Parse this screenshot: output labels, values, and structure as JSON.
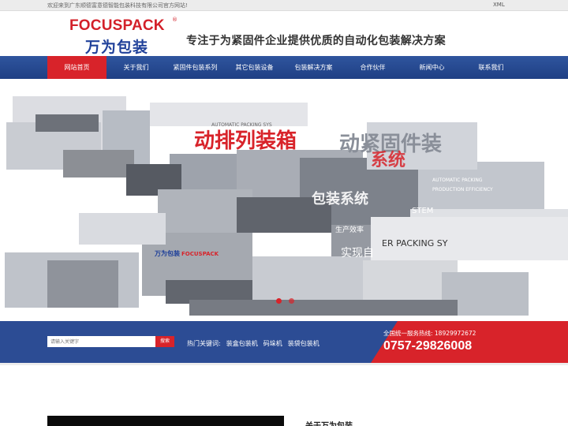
{
  "topbar": {
    "welcome": "欢迎来到广东顺德富意德智能包装科技有限公司官方网站!",
    "xml": "XML"
  },
  "header": {
    "logo_en": "FOCUSPACK",
    "logo_reg": "®",
    "logo_cn": "万为包装",
    "slogan": "专注于为紧固件企业提供优质的自动化包装解决方案"
  },
  "nav": {
    "items": [
      {
        "label": "网站首页"
      },
      {
        "label": "关于我们"
      },
      {
        "label": "紧固件包装系列"
      },
      {
        "label": "其它包装设备"
      },
      {
        "label": "包装解决方案"
      },
      {
        "label": "合作伙伴"
      },
      {
        "label": "新闻中心"
      },
      {
        "label": "联系我们"
      }
    ]
  },
  "banner": {
    "texts": {
      "t1": "动排列装箱",
      "t2": "动紧固件装",
      "t3": "系统",
      "t4": "AUTOMATIC PACKING SYS",
      "t5": "AUTOMATIC PACKING",
      "t6": "PRODUCTION EFFICIENCY",
      "t7": "STEM",
      "t8": "ER PACKING SY",
      "t9": "实现自",
      "t10": "包装系统",
      "t11": "生产效率",
      "t12": "FOCUSPACK",
      "t13": "万为包装"
    },
    "colors": {
      "red": "#d8232a",
      "gray": "#8a8f99"
    }
  },
  "search": {
    "placeholder": "请输入关键字",
    "button": "搜索",
    "hot_label": "热门关键词:",
    "keywords": [
      "装盒包装机",
      "码垛机",
      "装袋包装机"
    ]
  },
  "contact": {
    "label": "全国统一服务热线: 18929972672",
    "phone": "0757-29826008"
  },
  "about": {
    "title": "关于万为包装"
  }
}
